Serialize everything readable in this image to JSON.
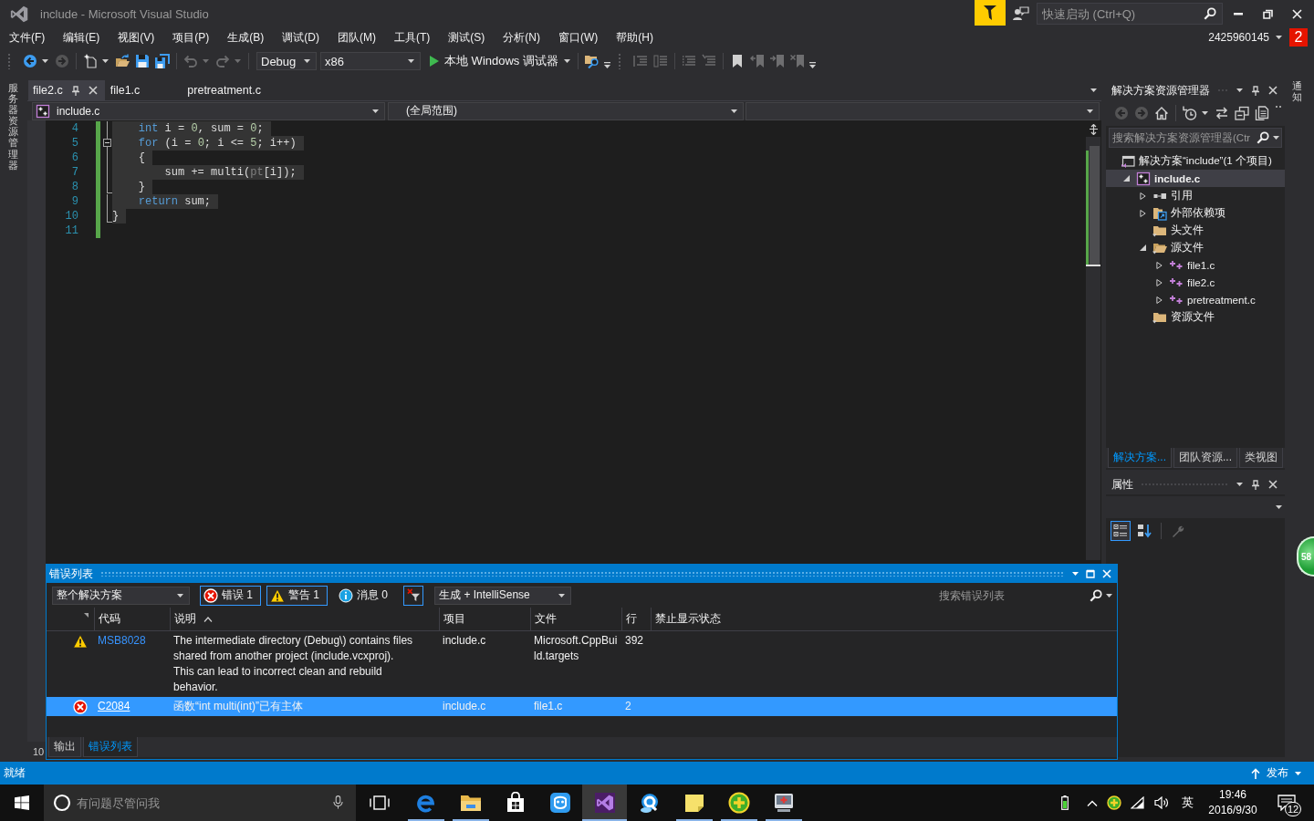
{
  "window": {
    "title": "include - Microsoft Visual Studio",
    "quick_launch": {
      "placeholder": "快速启动 (Ctrl+Q)"
    },
    "account": {
      "name": "2425960145",
      "badge": "2"
    }
  },
  "menu": [
    "文件(F)",
    "编辑(E)",
    "视图(V)",
    "项目(P)",
    "生成(B)",
    "调试(D)",
    "团队(M)",
    "工具(T)",
    "测试(S)",
    "分析(N)",
    "窗口(W)",
    "帮助(H)"
  ],
  "toolbar": {
    "items": [
      {
        "kind": "grip"
      },
      {
        "kind": "back",
        "disabled": false
      },
      {
        "kind": "menu-arrow",
        "disabled": false
      },
      {
        "kind": "forward",
        "disabled": true
      },
      {
        "kind": "separator"
      },
      {
        "kind": "new-project",
        "disabled": false
      },
      {
        "kind": "menu-arrow",
        "disabled": false
      },
      {
        "kind": "open-folder",
        "disabled": false
      },
      {
        "kind": "save",
        "disabled": false
      },
      {
        "kind": "save-all",
        "disabled": false
      },
      {
        "kind": "separator"
      },
      {
        "kind": "undo",
        "disabled": true
      },
      {
        "kind": "menu-arrow",
        "disabled": true
      },
      {
        "kind": "redo",
        "disabled": true
      },
      {
        "kind": "menu-arrow",
        "disabled": true
      },
      {
        "kind": "separator"
      },
      {
        "kind": "configuration",
        "value": "Debug"
      },
      {
        "kind": "platform",
        "value": "x86"
      },
      {
        "kind": "run",
        "label": "本地 Windows 调试器"
      },
      {
        "kind": "separator"
      },
      {
        "kind": "folder-search",
        "disabled": false
      },
      {
        "kind": "overflow"
      },
      {
        "kind": "grip"
      },
      {
        "kind": "outdent",
        "disabled": true
      },
      {
        "kind": "indent",
        "disabled": true
      },
      {
        "kind": "separator"
      },
      {
        "kind": "comment-lines",
        "disabled": true
      },
      {
        "kind": "uncomment-lines",
        "disabled": true
      },
      {
        "kind": "separator"
      },
      {
        "kind": "bookmark",
        "disabled": false
      },
      {
        "kind": "previous-bookmark",
        "disabled": true
      },
      {
        "kind": "next-bookmark",
        "disabled": true
      },
      {
        "kind": "clear-bookmarks",
        "disabled": true
      },
      {
        "kind": "overflow"
      }
    ]
  },
  "left_strip": {
    "label": "服务器资源管理器"
  },
  "editor": {
    "tabs": [
      {
        "label": "file2.c",
        "selected": true
      },
      {
        "label": "file1.c",
        "selected": false
      },
      {
        "label": "pretreatment.c",
        "selected": false
      }
    ],
    "navigation": {
      "file": "include.c",
      "scope": "(全局范围)"
    },
    "lines": [
      {
        "number": "4",
        "changed": true,
        "kind": "guide",
        "highlighted": true,
        "tokens": [
          {
            "text": "    int",
            "kind": "keyword"
          },
          {
            "text": " i = ",
            "kind": "plain"
          },
          {
            "text": "0",
            "kind": "number"
          },
          {
            "text": ", sum = ",
            "kind": "plain"
          },
          {
            "text": "0",
            "kind": "number"
          },
          {
            "text": ";",
            "kind": "plain"
          }
        ]
      },
      {
        "number": "5",
        "changed": true,
        "kind": "fold",
        "highlighted": true,
        "tokens": [
          {
            "text": "    for",
            "kind": "keyword"
          },
          {
            "text": " (i = ",
            "kind": "plain"
          },
          {
            "text": "0",
            "kind": "number"
          },
          {
            "text": "; i <= ",
            "kind": "plain"
          },
          {
            "text": "5",
            "kind": "number"
          },
          {
            "text": "; i++)",
            "kind": "plain"
          }
        ]
      },
      {
        "number": "6",
        "changed": true,
        "kind": "guide",
        "highlighted": true,
        "tokens": [
          {
            "text": "    {",
            "kind": "plain"
          }
        ]
      },
      {
        "number": "7",
        "changed": true,
        "kind": "guide",
        "highlighted": true,
        "tokens": [
          {
            "text": "        sum += multi(",
            "kind": "plain"
          },
          {
            "text": "pt",
            "kind": "dim"
          },
          {
            "text": "[i]);",
            "kind": "plain"
          }
        ]
      },
      {
        "number": "8",
        "changed": true,
        "kind": "end",
        "highlighted": true,
        "tokens": [
          {
            "text": "    }",
            "kind": "plain"
          }
        ]
      },
      {
        "number": "9",
        "changed": true,
        "kind": "guide",
        "highlighted": true,
        "tokens": [
          {
            "text": "    return",
            "kind": "keyword"
          },
          {
            "text": " sum;",
            "kind": "plain"
          }
        ]
      },
      {
        "number": "10",
        "changed": true,
        "kind": "end",
        "highlighted": true,
        "tokens": [
          {
            "text": "}",
            "kind": "plain"
          }
        ]
      },
      {
        "number": "11",
        "changed": true,
        "kind": "plain"
      }
    ],
    "zoom": "10"
  },
  "error_list": {
    "title": "错误列表",
    "scope": "整个解决方案",
    "filters": [
      {
        "kind": "error",
        "label": "错误 1",
        "selected": true
      },
      {
        "kind": "warning",
        "label": "警告 1",
        "selected": true
      },
      {
        "kind": "message",
        "label": "消息 0",
        "selected": false
      }
    ],
    "filter_button": {
      "selected": true
    },
    "source": "生成 + IntelliSense",
    "search": {
      "placeholder": "搜索错误列表"
    },
    "columns": [
      {
        "label": "代码",
        "sorted": false
      },
      {
        "label": "说明",
        "sorted": true
      },
      {
        "label": "项目",
        "sorted": false
      },
      {
        "label": "文件",
        "sorted": false
      },
      {
        "label": "行",
        "sorted": false
      },
      {
        "label": "禁止显示状态",
        "sorted": false
      }
    ],
    "rows": [
      {
        "kind": "warning",
        "code": "MSB8028",
        "description": "The intermediate directory (Debug\\) contains files shared from another project (include.vcxproj). This can lead to incorrect clean and rebuild behavior.",
        "project": "include.c",
        "file": "Microsoft.CppBuild.targets",
        "line": "392",
        "selected": false
      },
      {
        "kind": "error",
        "code": "C2084",
        "description": "函数“int multi(int)”已有主体",
        "project": "include.c",
        "file": "file1.c",
        "line": "2",
        "selected": true
      }
    ],
    "bottom_tabs": [
      {
        "label": "输出",
        "selected": false
      },
      {
        "label": "错误列表",
        "selected": true
      }
    ]
  },
  "solution_explorer": {
    "title": "解决方案资源管理器",
    "toolbar": [
      {
        "kind": "back",
        "disabled": true
      },
      {
        "kind": "forward",
        "disabled": true
      },
      {
        "kind": "home",
        "disabled": false
      },
      {
        "kind": "separator"
      },
      {
        "kind": "history",
        "disabled": false
      },
      {
        "kind": "menu-arrow",
        "disabled": false
      },
      {
        "kind": "sync",
        "disabled": false
      },
      {
        "kind": "collapse-all",
        "disabled": false
      },
      {
        "kind": "show-all-files",
        "disabled": false
      }
    ],
    "search": {
      "placeholder": "搜索解决方案资源管理器(Ctr"
    },
    "tree": [
      {
        "label": "解决方案“include”(1 个项目)",
        "kind": "solution",
        "selected": false,
        "children": [
          {
            "label": "include.c",
            "kind": "project",
            "expanded": true,
            "selected": true,
            "children": [
              {
                "label": "引用",
                "kind": "references",
                "expanded": false,
                "selected": false
              },
              {
                "label": "外部依赖项",
                "kind": "dependencies",
                "expanded": false,
                "selected": false
              },
              {
                "label": "头文件",
                "kind": "folder",
                "selected": false
              },
              {
                "label": "源文件",
                "kind": "folder",
                "expanded": true,
                "selected": false,
                "children": [
                  {
                    "label": "file1.c",
                    "kind": "source",
                    "expanded": false,
                    "selected": false
                  },
                  {
                    "label": "file2.c",
                    "kind": "source",
                    "expanded": false,
                    "selected": false
                  },
                  {
                    "label": "pretreatment.c",
                    "kind": "source",
                    "expanded": false,
                    "selected": false
                  }
                ]
              },
              {
                "label": "资源文件",
                "kind": "folder",
                "selected": false
              }
            ]
          }
        ]
      }
    ],
    "tabs": [
      {
        "label": "解决方案...",
        "selected": true
      },
      {
        "label": "团队资源...",
        "selected": false
      },
      {
        "label": "类视图",
        "selected": false
      }
    ]
  },
  "properties": {
    "title": "属性",
    "toolbar": [
      {
        "kind": "categorized",
        "selected": true,
        "disabled": false
      },
      {
        "kind": "alphabetical",
        "selected": false,
        "disabled": false
      },
      {
        "kind": "separator"
      },
      {
        "kind": "property-pages",
        "selected": false,
        "disabled": true
      }
    ]
  },
  "right_strip": {
    "label": "通知"
  },
  "floating_ball": {
    "label": "58"
  },
  "status_bar": {
    "text": "就绪",
    "publish": "发布"
  },
  "taskbar": {
    "search": {
      "placeholder": "有问题尽管问我"
    },
    "apps": [
      {
        "kind": "e-logo",
        "running": true,
        "selected": false
      },
      {
        "kind": "folder",
        "running": true,
        "selected": false
      },
      {
        "kind": "shopping-bag",
        "running": false,
        "selected": false
      },
      {
        "kind": "app-tile",
        "running": false,
        "selected": false
      },
      {
        "kind": "ribbon-logo",
        "running": true,
        "selected": true
      },
      {
        "kind": "ring-logo",
        "running": false,
        "selected": false
      },
      {
        "kind": "sticky-note",
        "running": true,
        "selected": false
      },
      {
        "kind": "plus-circle",
        "running": true,
        "selected": false
      },
      {
        "kind": "monitor",
        "running": true,
        "selected": false
      }
    ],
    "input_method": "英",
    "time": "19:46",
    "date": "2016/9/30",
    "notifications": "12"
  }
}
